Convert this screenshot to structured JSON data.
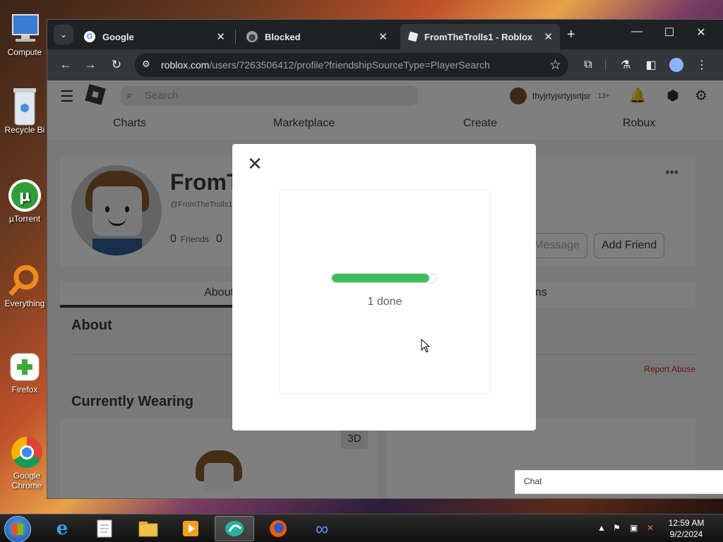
{
  "desktop": {
    "icons": [
      {
        "label": "Compute",
        "icon": "computer-icon"
      },
      {
        "label": "Recycle Bi",
        "icon": "recycle-bin-icon"
      },
      {
        "label": "µTorrent",
        "icon": "utorrent-icon"
      },
      {
        "label": "Everything",
        "icon": "search-app-icon"
      },
      {
        "label": "Firefox",
        "icon": "firefox-icon"
      },
      {
        "label": "Google Chrome",
        "icon": "chrome-icon"
      }
    ]
  },
  "browser": {
    "tabs": [
      {
        "title": "Google",
        "icon": "google-icon"
      },
      {
        "title": "Blocked",
        "icon": "globe-icon"
      },
      {
        "title": "FromTheTrolls1 - Roblox",
        "icon": "roblox-icon"
      }
    ],
    "url_domain": "roblox.com",
    "url_path": "/users/7263506412/profile?friendshipSourceType=PlayerSearch"
  },
  "roblox": {
    "search_placeholder": "Search",
    "username": "thyjrtyjsrtyjsrtjsr",
    "age_badge": "13+",
    "nav": [
      "Charts",
      "Marketplace",
      "Create",
      "Robux"
    ],
    "profile": {
      "name": "FromT",
      "handle": "@FromTheTrolls1",
      "friends_count": "0",
      "friends_label": "Friends",
      "second_count": "0",
      "message_button": "Message",
      "add_friend_button": "Add Friend",
      "more_menu": "•••"
    },
    "tabs": {
      "about": "About",
      "creations": "ions"
    },
    "about_heading": "About",
    "report_abuse": "Report Abuse",
    "currently_wearing": "Currently Wearing",
    "btn_3d": "3D",
    "chat": "Chat"
  },
  "modal": {
    "close_glyph": "✕",
    "progress_fraction": 0.93,
    "progress_text": "1 done"
  },
  "taskbar": {
    "time": "12:59 AM",
    "date": "9/2/2024"
  },
  "colors": {
    "progress_green": "#3ebd5e",
    "report_red": "#d0292a"
  }
}
